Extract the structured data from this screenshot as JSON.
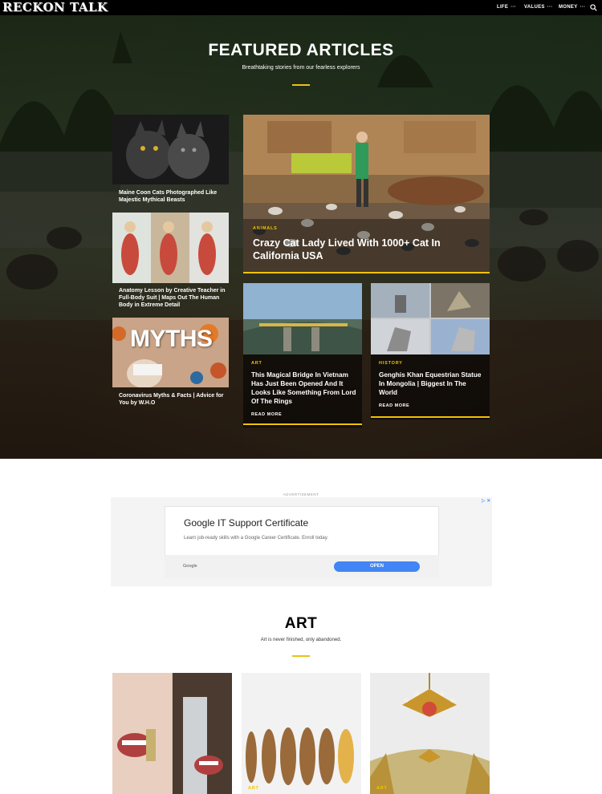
{
  "site": {
    "logo": "RECKON TALK"
  },
  "nav": {
    "items": [
      {
        "label": "LIFE",
        "dots": "···"
      },
      {
        "label": "VALUES",
        "dots": "···"
      },
      {
        "label": "MONEY",
        "dots": "···"
      }
    ]
  },
  "featured": {
    "title": "FEATURED ARTICLES",
    "subtitle": "Breathtaking stories from our fearless explorers",
    "small_cards": [
      {
        "caption": "Maine Coon Cats Photographed Like Majestic Mythical Beasts"
      },
      {
        "caption": "Anatomy Lesson by Creative Teacher in Full-Body Suit | Maps Out The Human Body in Extreme Detail"
      },
      {
        "caption": "Coronavirus Myths & Facts | Advice for You by W.H.O",
        "image_text": "MYTHS"
      }
    ],
    "main_card": {
      "category": "ANIMALS",
      "title": "Crazy Cat Lady Lived With 1000+ Cat In California USA"
    },
    "bridge_card": {
      "category": "ART",
      "title": "This Magical Bridge In Vietnam Has Just Been Opened And It Looks Like Something From Lord Of The Rings",
      "read_more": "READ MORE"
    },
    "statue_card": {
      "category": "HISTORY",
      "title": "Genghis Khan Equestrian Statue In Mongolia | Biggest In The World",
      "read_more": "READ MORE"
    }
  },
  "ad": {
    "label": "ADVERTISEMENT",
    "title": "Google IT Support Certificate",
    "description": "Learn job-ready skills with a Google Career Certificate. Enroll today.",
    "brand": "Google",
    "cta": "OPEN",
    "choices": "▷ ✕"
  },
  "art_section": {
    "title": "ART",
    "subtitle": "Art is never finished, only abandoned.",
    "cards": [
      {
        "category": ""
      },
      {
        "category": "ART"
      },
      {
        "category": "ART"
      }
    ]
  },
  "colors": {
    "accent": "#f2c200",
    "nav_bg": "#000000",
    "ad_button": "#4285f4"
  }
}
